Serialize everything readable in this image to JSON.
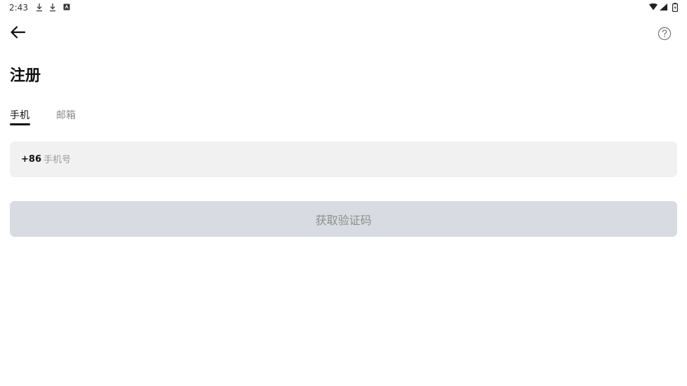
{
  "status_bar": {
    "time": "2:43",
    "icons": [
      "download-icon",
      "download-icon",
      "app-badge-icon",
      "wifi-icon",
      "signal-icon",
      "battery-icon"
    ]
  },
  "toolbar": {
    "back_icon": "arrow-left-icon",
    "help_icon": "question-circle-icon"
  },
  "title": "注册",
  "tabs": [
    {
      "label": "手机",
      "selected": true
    },
    {
      "label": "邮箱",
      "selected": false
    }
  ],
  "phone": {
    "country_code": "+86",
    "value": "",
    "placeholder": "手机号"
  },
  "submit": {
    "label": "获取验证码",
    "enabled": false
  },
  "colors": {
    "input_bg": "#f1f1f1",
    "button_disabled_bg": "#d8dbe2",
    "button_disabled_text": "#8e8e8e",
    "tab_inactive": "#8a8a8a",
    "text_primary": "#111111"
  }
}
